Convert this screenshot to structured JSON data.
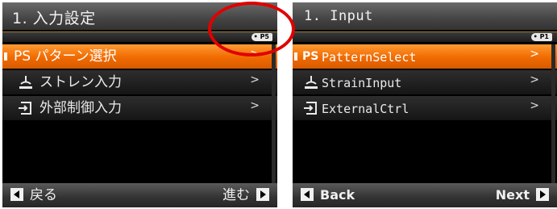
{
  "left_screen": {
    "title": "1. 入力設定",
    "mode_badge": "P5",
    "menu": [
      {
        "icon": "PS",
        "label": "PS パターン選択",
        "arrow": ">",
        "selected": true
      },
      {
        "icon": "strain-icon",
        "label": "ストレン入力",
        "arrow": ">",
        "selected": false
      },
      {
        "icon": "external-ctrl-icon",
        "label": "外部制御入力",
        "arrow": ">",
        "selected": false
      }
    ],
    "footer": {
      "back": "戻る",
      "next": "進む"
    }
  },
  "right_screen": {
    "title": "1. Input",
    "mode_badge": "P1",
    "menu": [
      {
        "icon": "PS",
        "label": "PatternSelect",
        "arrow": ">",
        "selected": true
      },
      {
        "icon": "strain-icon",
        "label": "StrainInput",
        "arrow": ">",
        "selected": false
      },
      {
        "icon": "external-ctrl-icon",
        "label": "ExternalCtrl",
        "arrow": ">",
        "selected": false
      }
    ],
    "footer": {
      "back": "Back",
      "next": "Next"
    }
  },
  "colors": {
    "selected_item": "#f07a10",
    "highlight_circle": "#e00000",
    "background": "#000000"
  }
}
